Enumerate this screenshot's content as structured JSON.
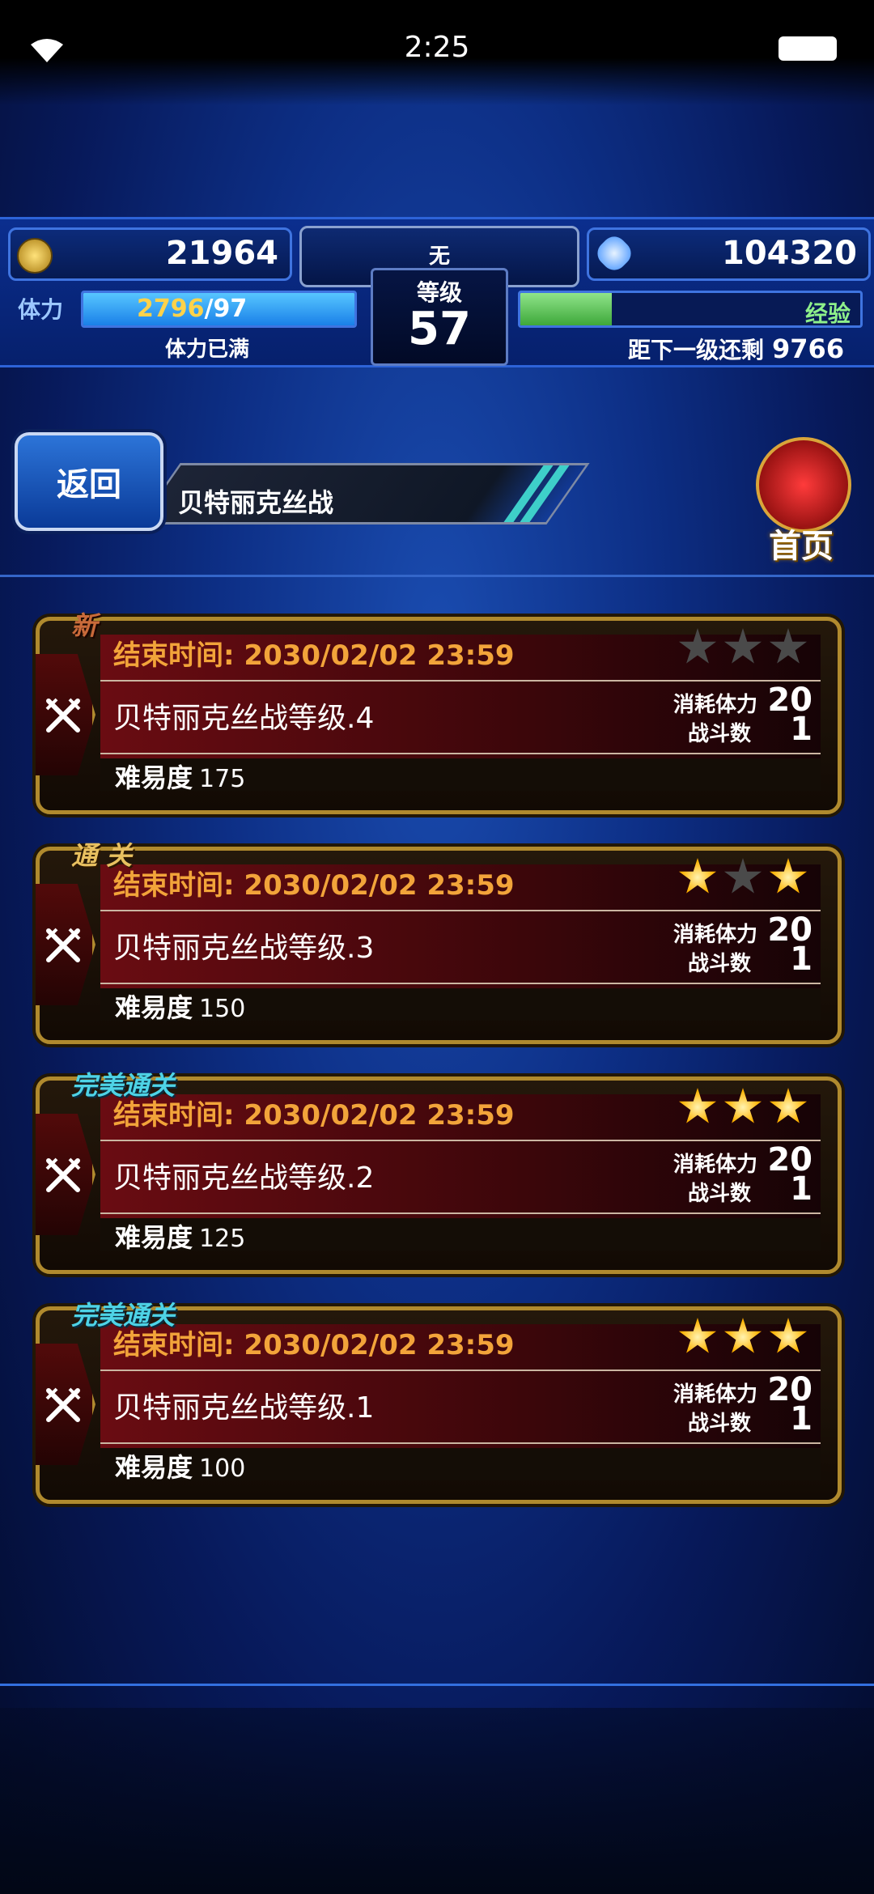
{
  "status_bar": {
    "time": "2:25"
  },
  "hud": {
    "gold": "21964",
    "gems": "104320",
    "rank_title": "无",
    "level_label": "等级",
    "level": "57",
    "stamina_label": "体力",
    "stamina_current": "2796",
    "stamina_max": "/97",
    "stamina_fill_fraction": 1.0,
    "stamina_status": "体力已满",
    "exp_label": "经验",
    "exp_fill_fraction": 0.27,
    "exp_remaining_label": "距下一级还剩",
    "exp_remaining": "9766"
  },
  "header": {
    "back_label": "返回",
    "title": "贝特丽克丝战",
    "home_label": "首页"
  },
  "quests": [
    {
      "tag": "新",
      "end_time": "结束时间: 2030/02/02 23:59",
      "name": "贝特丽克丝战等级.4",
      "difficulty_label": "难易度",
      "difficulty": "175",
      "stars": [
        false,
        false,
        false
      ],
      "stamina_cost_label": "消耗体力",
      "stamina_cost": "20",
      "battles_label": "战斗数",
      "battles": "1"
    },
    {
      "tag": "通 关",
      "end_time": "结束时间: 2030/02/02 23:59",
      "name": "贝特丽克丝战等级.3",
      "difficulty_label": "难易度",
      "difficulty": "150",
      "stars": [
        true,
        false,
        true
      ],
      "stamina_cost_label": "消耗体力",
      "stamina_cost": "20",
      "battles_label": "战斗数",
      "battles": "1"
    },
    {
      "tag": "完美通关",
      "end_time": "结束时间: 2030/02/02 23:59",
      "name": "贝特丽克丝战等级.2",
      "difficulty_label": "难易度",
      "difficulty": "125",
      "stars": [
        true,
        true,
        true
      ],
      "stamina_cost_label": "消耗体力",
      "stamina_cost": "20",
      "battles_label": "战斗数",
      "battles": "1"
    },
    {
      "tag": "完美通关",
      "end_time": "结束时间: 2030/02/02 23:59",
      "name": "贝特丽克丝战等级.1",
      "difficulty_label": "难易度",
      "difficulty": "100",
      "stars": [
        true,
        true,
        true
      ],
      "stamina_cost_label": "消耗体力",
      "stamina_cost": "20",
      "battles_label": "战斗数",
      "battles": "1"
    }
  ],
  "icons": {
    "wifi": "wifi-icon",
    "battery": "battery-icon",
    "coin": "gil-coin-icon",
    "gem": "crystal-gem-icon",
    "sword": "crossed-swords-icon",
    "home": "home-emblem-icon"
  },
  "colors": {
    "accent_blue": "#1a4cb0",
    "gold_border": "#b08a2e",
    "orange_text": "#f2a43a",
    "star_on": "#ffb300",
    "stamina_number": "#ffd24a",
    "exp_green": "#3ea83a"
  }
}
